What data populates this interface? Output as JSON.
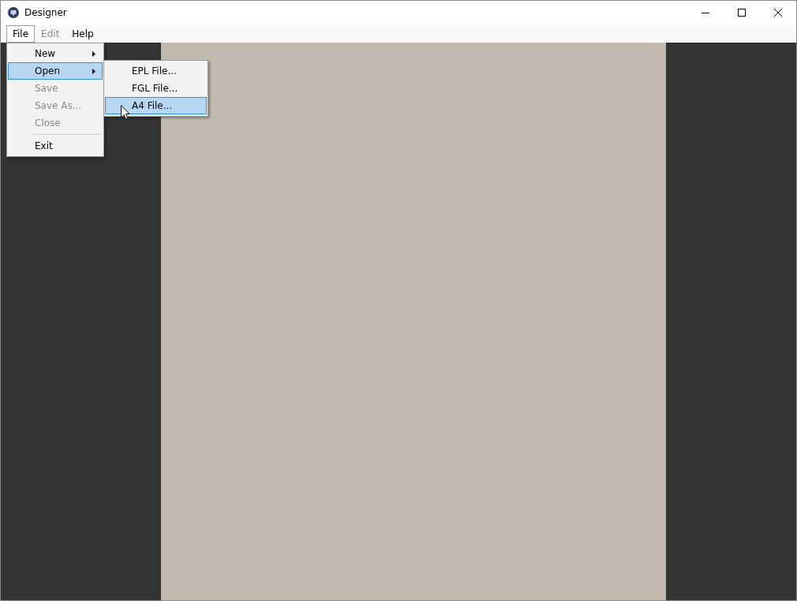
{
  "window": {
    "title": "Designer"
  },
  "menubar": [
    {
      "label": "File",
      "selected": true,
      "disabled": false
    },
    {
      "label": "Edit",
      "selected": false,
      "disabled": true
    },
    {
      "label": "Help",
      "selected": false,
      "disabled": false
    }
  ],
  "file_menu": [
    {
      "kind": "item",
      "label": "New",
      "disabled": false,
      "selected": false,
      "submenu": true
    },
    {
      "kind": "item",
      "label": "Open",
      "disabled": false,
      "selected": true,
      "submenu": true
    },
    {
      "kind": "item",
      "label": "Save",
      "disabled": true,
      "selected": false,
      "submenu": false
    },
    {
      "kind": "item",
      "label": "Save As...",
      "disabled": true,
      "selected": false,
      "submenu": false
    },
    {
      "kind": "item",
      "label": "Close",
      "disabled": true,
      "selected": false,
      "submenu": false
    },
    {
      "kind": "separator"
    },
    {
      "kind": "item",
      "label": "Exit",
      "disabled": false,
      "selected": false,
      "submenu": false
    }
  ],
  "open_submenu": [
    {
      "label": "EPL File...",
      "selected": false
    },
    {
      "label": "FGL File...",
      "selected": false
    },
    {
      "label": "A4 File...",
      "selected": true
    }
  ]
}
